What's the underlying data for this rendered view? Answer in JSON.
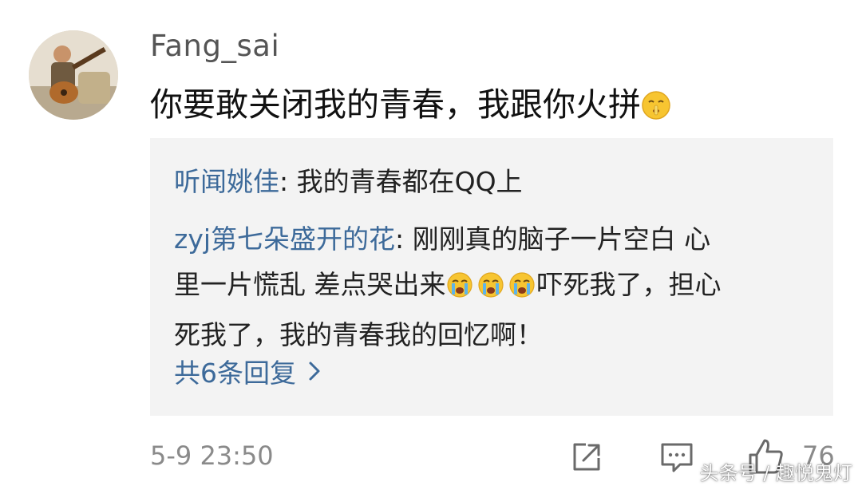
{
  "comment": {
    "username": "Fang_sai",
    "text": "你要敢关闭我的青春，我跟你火拼",
    "emoji": "shush-face-emoji",
    "timestamp": "5-9 23:50",
    "like_count": "76"
  },
  "replies": [
    {
      "author": "听闻姚佳",
      "separator": ": ",
      "text": "我的青春都在QQ上"
    },
    {
      "author": "zyj第七朵盛开的花",
      "separator": ": ",
      "text_line1": "刚刚真的脑子一片空白 心",
      "text_line2a": "里一片慌乱 差点哭出来",
      "emoji": "crying-face-emoji",
      "text_line2b": "吓死我了，担心",
      "text_line3": "死我了，我的青春我的回忆啊！"
    }
  ],
  "more_replies_label": "共6条回复",
  "watermark": "头条号 / 趣悦鬼灯",
  "colors": {
    "link": "#3d6a9a",
    "reply_bg": "#f3f3f3",
    "meta_text": "#8a8a8a"
  }
}
